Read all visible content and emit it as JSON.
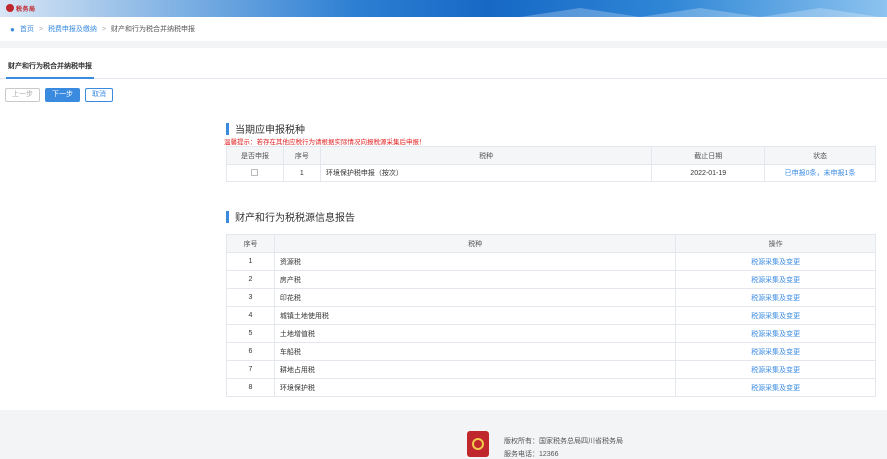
{
  "banner": {
    "logo_text": "税务局"
  },
  "breadcrumb": {
    "home": "首页",
    "level2": "税费申报及缴纳",
    "current": "财产和行为税合并纳税申报"
  },
  "tab": {
    "label": "财产和行为税合并纳税申报"
  },
  "buttons": {
    "prev": "上一步",
    "next": "下一步",
    "cancel": "取消"
  },
  "section1": {
    "title": "当期应申报税种",
    "headers": [
      "是否申报",
      "序号",
      "税种",
      "截止日期",
      "状态"
    ],
    "rows": [
      {
        "index": "1",
        "tax": "环境保护税申报（按次）",
        "deadline": "2022-01-19",
        "status": "已申报0条，未申报1条"
      }
    ],
    "warning": "温馨提示：若存在其他应税行为请根据实际情况向报税源采集后申报！"
  },
  "section2": {
    "title": "财产和行为税税源信息报告",
    "headers": [
      "序号",
      "税种",
      "操作"
    ],
    "action_label": "税源采集及变更",
    "rows": [
      {
        "index": "1",
        "tax": "资源税"
      },
      {
        "index": "2",
        "tax": "房产税"
      },
      {
        "index": "3",
        "tax": "印花税"
      },
      {
        "index": "4",
        "tax": "城镇土地使用税"
      },
      {
        "index": "5",
        "tax": "土地增值税"
      },
      {
        "index": "6",
        "tax": "车船税"
      },
      {
        "index": "7",
        "tax": "耕地占用税"
      },
      {
        "index": "8",
        "tax": "环境保护税"
      }
    ]
  },
  "footer": {
    "copyright": "版权所有：国家税务总局四川省税务局",
    "phone": "服务电话：12366"
  },
  "colors": {
    "accent": "#3a8be0",
    "warning": "#e02020",
    "brand": "#c0272d"
  }
}
